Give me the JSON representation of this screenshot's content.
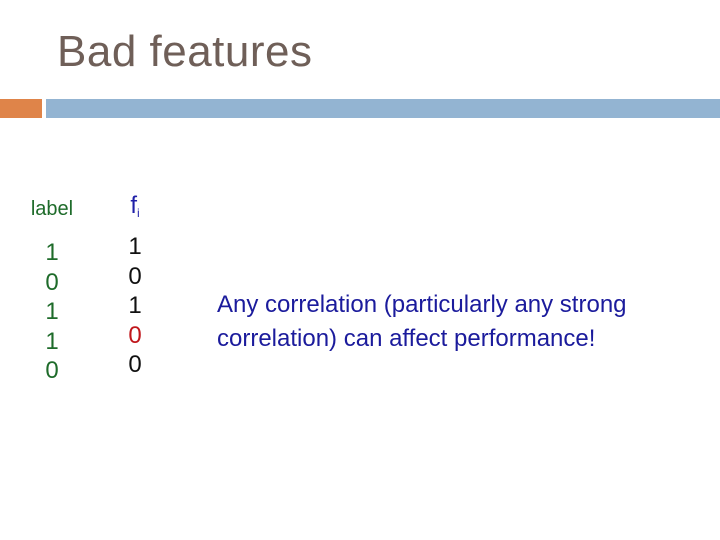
{
  "slide": {
    "title": "Bad features",
    "accent_colors": {
      "orange": "#df8449",
      "blue": "#93b4d2"
    }
  },
  "table": {
    "label_header": "label",
    "feature_header": "f",
    "feature_header_subscript": "i",
    "label_values": [
      "1",
      "0",
      "1",
      "1",
      "0"
    ],
    "feature_values": [
      {
        "value": "1",
        "color": "#111111"
      },
      {
        "value": "0",
        "color": "#111111"
      },
      {
        "value": "1",
        "color": "#111111"
      },
      {
        "value": "0",
        "color": "#c0161b"
      },
      {
        "value": "0",
        "color": "#111111"
      }
    ]
  },
  "note": "Any correlation (particularly any strong correlation) can affect performance!"
}
